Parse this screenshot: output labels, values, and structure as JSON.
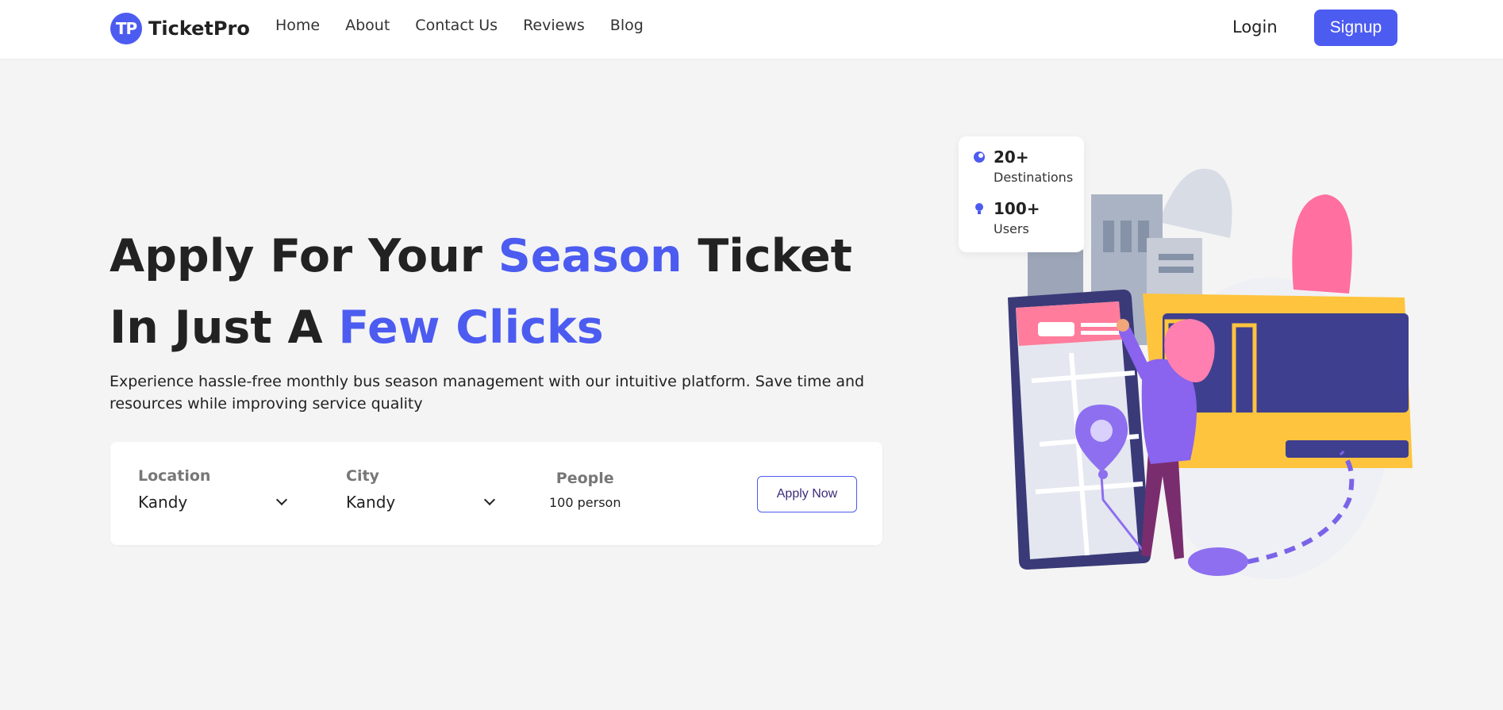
{
  "nav": {
    "logo_mark": "TP",
    "brand": "TicketPro",
    "links": [
      "Home",
      "About",
      "Contact Us",
      "Reviews",
      "Blog"
    ],
    "login": "Login",
    "signup": "Signup"
  },
  "hero": {
    "title_1": "Apply For Your ",
    "title_accent_1": "Season",
    "title_2": " Ticket In Just A ",
    "title_accent_2": "Few Clicks",
    "description": "Experience hassle-free monthly bus season management with our intuitive platform. Save time and resources while improving service quality"
  },
  "search": {
    "location_label": "Location",
    "location_value": "Kandy",
    "city_label": "City",
    "city_value": "Kandy",
    "people_label": "People",
    "people_value": "100 person",
    "apply": "Apply Now"
  },
  "stats": [
    {
      "value": "20+",
      "label": "Destinations",
      "icon": "globe-icon"
    },
    {
      "value": "100+",
      "label": "Users",
      "icon": "user-icon"
    }
  ],
  "colors": {
    "accent": "#4c5bf0",
    "background": "#f4f4f4",
    "bus": "#ffc43d",
    "pink": "#ff6f9f"
  }
}
